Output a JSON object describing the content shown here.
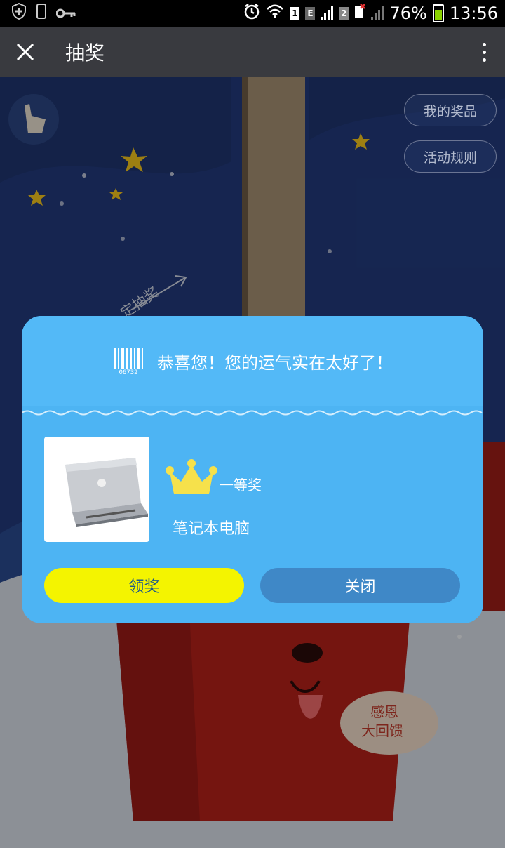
{
  "status_bar": {
    "battery": "76%",
    "time": "13:56",
    "sim1": "1",
    "sim1_net": "E",
    "sim2": "2"
  },
  "title_bar": {
    "title": "抽奖"
  },
  "side_buttons": {
    "my_prizes": "我的奖品",
    "rules": "活动规则"
  },
  "scene": {
    "arrow_text": "定抽奖",
    "bubble_line1": "感恩",
    "bubble_line2": "大回馈"
  },
  "modal": {
    "barcode_number": "06732",
    "congrats_text": "恭喜您！您的运气实在太好了！",
    "prize_rank": "一等奖",
    "prize_name": "笔记本电脑",
    "claim_label": "领奖",
    "close_label": "关闭"
  },
  "colors": {
    "modal_bg": "#4db4f3",
    "claim_button": "#f4f400",
    "close_button": "#3f88c7",
    "titlebar": "#393a3f"
  }
}
